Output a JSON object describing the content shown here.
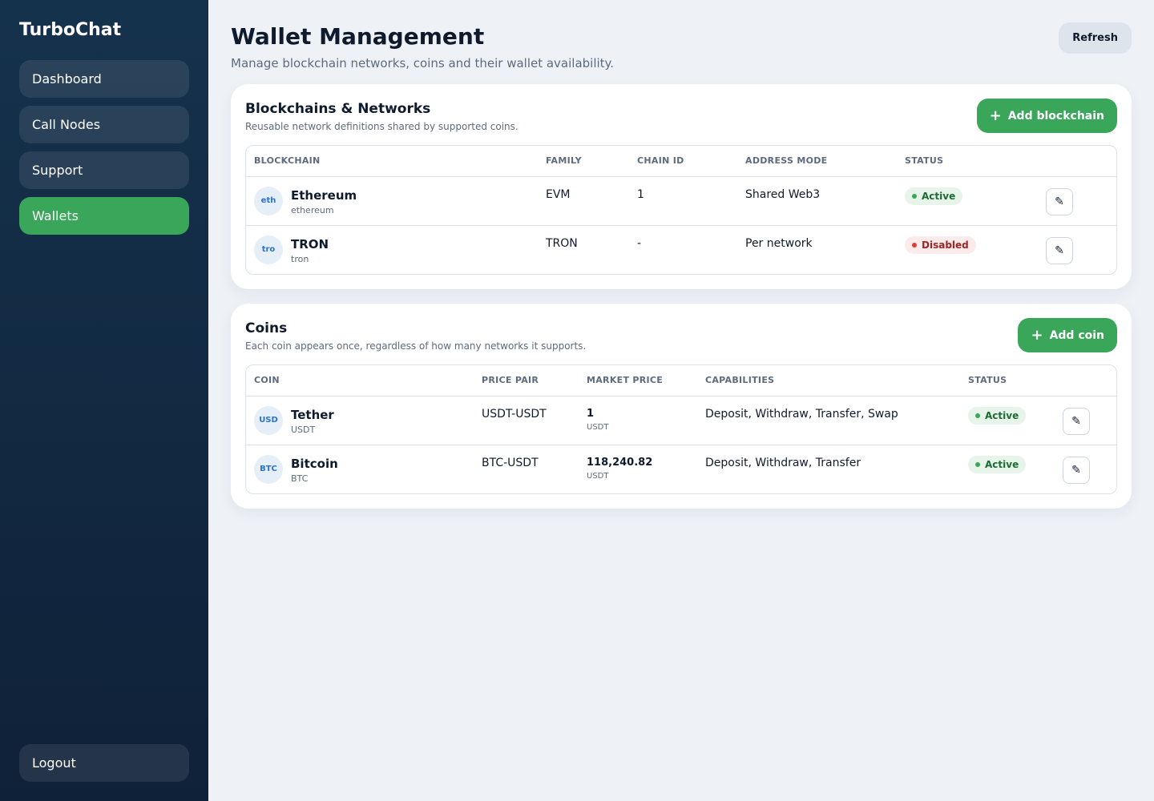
{
  "app": {
    "brand": "TurboChat"
  },
  "sidebar": {
    "items": [
      {
        "label": "Dashboard",
        "active": false
      },
      {
        "label": "Call Nodes",
        "active": false
      },
      {
        "label": "Support",
        "active": false
      },
      {
        "label": "Wallets",
        "active": true
      }
    ],
    "logout_label": "Logout"
  },
  "header": {
    "title": "Wallet Management",
    "subtitle": "Manage blockchain networks, coins and their wallet availability.",
    "refresh_label": "Refresh"
  },
  "blockchains": {
    "title": "Blockchains & Networks",
    "subtitle": "Reusable network definitions shared by supported coins.",
    "add_label": "Add blockchain",
    "columns": [
      "BLOCKCHAIN",
      "FAMILY",
      "CHAIN ID",
      "ADDRESS MODE",
      "STATUS"
    ],
    "rows": [
      {
        "avatar": "eth",
        "name": "Ethereum",
        "slug": "ethereum",
        "family": "EVM",
        "chain_id": "1",
        "address_mode": "Shared Web3",
        "status": "Active",
        "status_type": "active"
      },
      {
        "avatar": "tro",
        "name": "TRON",
        "slug": "tron",
        "family": "TRON",
        "chain_id": "-",
        "address_mode": "Per network",
        "status": "Disabled",
        "status_type": "disabled"
      }
    ]
  },
  "coins": {
    "title": "Coins",
    "subtitle": "Each coin appears once, regardless of how many networks it supports.",
    "add_label": "Add coin",
    "columns": [
      "COIN",
      "PRICE PAIR",
      "MARKET PRICE",
      "CAPABILITIES",
      "STATUS"
    ],
    "rows": [
      {
        "avatar": "USD",
        "name": "Tether",
        "symbol": "USDT",
        "pair": "USDT-USDT",
        "price": "1",
        "price_unit": "USDT",
        "capabilities": "Deposit, Withdraw, Transfer, Swap",
        "status": "Active",
        "status_type": "active"
      },
      {
        "avatar": "BTC",
        "name": "Bitcoin",
        "symbol": "BTC",
        "pair": "BTC-USDT",
        "price": "118,240.82",
        "price_unit": "USDT",
        "capabilities": "Deposit, Withdraw, Transfer",
        "status": "Active",
        "status_type": "active"
      }
    ]
  },
  "icons": {
    "add": "plus-icon",
    "edit": "pencil-icon"
  },
  "colors": {
    "accent": "#3aa65a",
    "sidebar": "#15324c",
    "danger": "#e53a3a"
  }
}
